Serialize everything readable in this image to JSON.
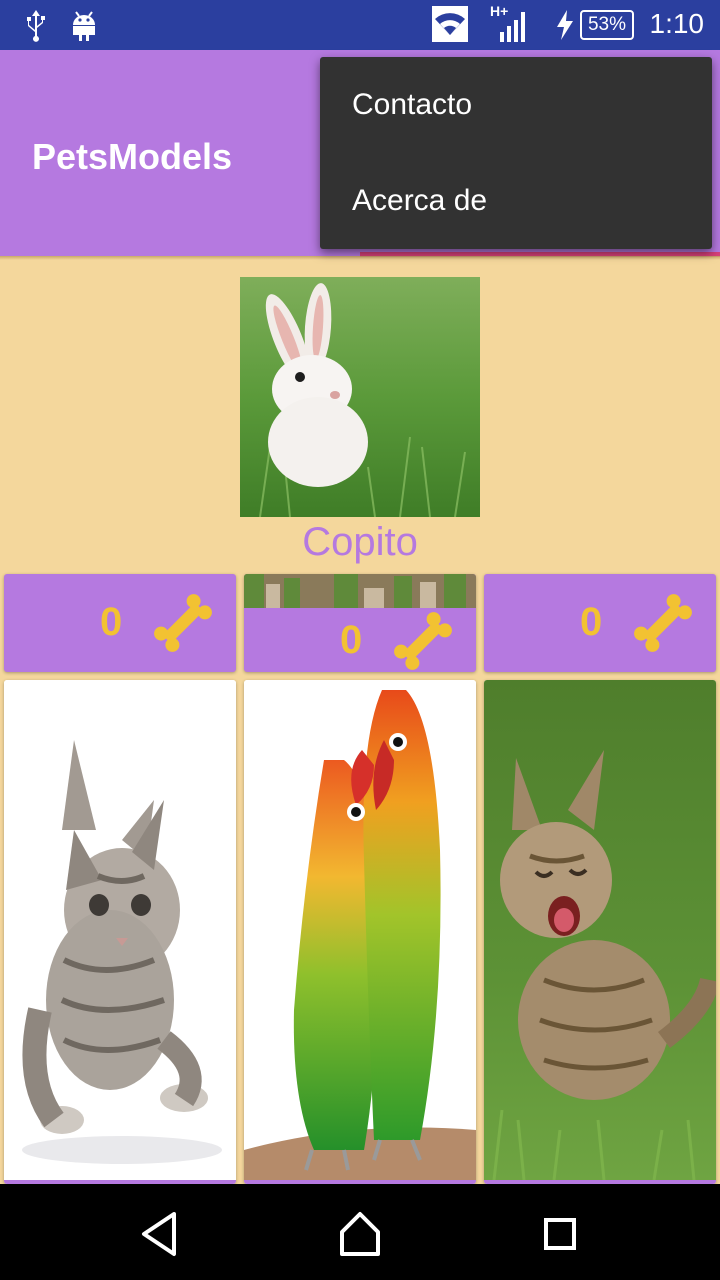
{
  "status_bar": {
    "battery": "53%",
    "time": "1:10",
    "network": "H+",
    "icons": [
      "usb-icon",
      "android-icon",
      "wifi-icon",
      "signal-icon",
      "charging-icon",
      "battery-icon"
    ]
  },
  "app_bar": {
    "title": "PetsModels"
  },
  "menu": {
    "items": [
      "Contacto",
      "Acerca de"
    ]
  },
  "featured": {
    "name": "Copito",
    "photo": "rabbit"
  },
  "cards_top": [
    {
      "likes": "0",
      "icon": "bone-icon"
    },
    {
      "likes": "0",
      "icon": "bone-icon"
    },
    {
      "likes": "0",
      "icon": "bone-icon"
    }
  ],
  "cards_bottom": [
    {
      "photo": "kitten"
    },
    {
      "photo": "lovebirds"
    },
    {
      "photo": "kitten-on-grass"
    }
  ],
  "nav": [
    "back-icon",
    "home-icon",
    "recents-icon"
  ],
  "colors": {
    "primary": "#b579e0",
    "accent": "#d8407a",
    "background": "#f4d79c",
    "like_count": "#f2c232",
    "status_bar": "#2b3f9f",
    "menu": "#323232"
  }
}
